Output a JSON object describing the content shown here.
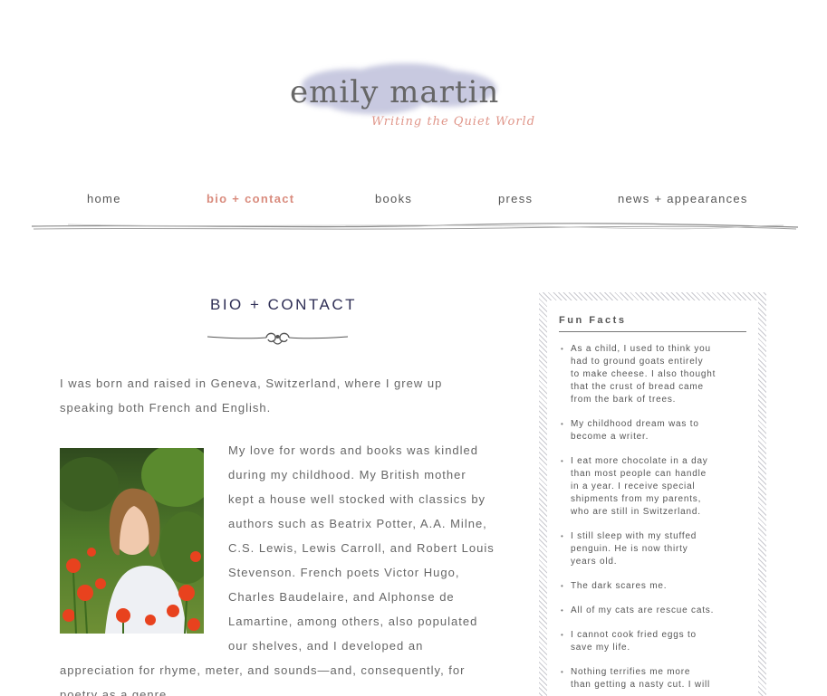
{
  "site": {
    "name": "emily martin",
    "tagline": "Writing the Quiet World"
  },
  "nav": {
    "items": [
      {
        "label": "home"
      },
      {
        "label": "bio + contact"
      },
      {
        "label": "books"
      },
      {
        "label": "press"
      },
      {
        "label": "news + appearances"
      }
    ],
    "active": "bio + contact"
  },
  "main": {
    "title": "BIO + CONTACT",
    "p1_lines": [
      "I was born and raised in Geneva, Switzerland, where I grew up",
      "speaking both French and English."
    ],
    "p2_lines": [
      "My love for words and books was kindled",
      "during my childhood. My British mother",
      "kept a house well stocked with classics by",
      "authors such as Beatrix Potter, A.A. Milne,",
      "C.S. Lewis, Lewis Carroll, and Robert Louis",
      "Stevenson. French poets Victor Hugo,",
      "Charles Baudelaire, and Alphonse de",
      "Lamartine, among others, also populated",
      "our shelves, and I developed an",
      "appreciation for rhyme, meter, and sounds—and, consequently, for",
      "poetry as a genre."
    ]
  },
  "sidebar": {
    "title": "Fun Facts",
    "facts": [
      [
        "As a child, I used to think you",
        "had to ground goats entirely",
        "to make cheese. I also thought",
        "that the crust of bread came",
        "from the bark of trees."
      ],
      [
        "My childhood dream was to",
        "become a writer."
      ],
      [
        "I eat more chocolate in a day",
        "than most people can handle",
        "in a year. I receive special",
        "shipments from my parents,",
        "who are still in Switzerland."
      ],
      [
        "I still sleep with my stuffed",
        "penguin. He is now thirty",
        "years old."
      ],
      [
        "The dark scares me."
      ],
      [
        "All of my cats are rescue cats."
      ],
      [
        "I cannot cook fried eggs to",
        "save my life."
      ],
      [
        "Nothing terrifies me more",
        "than getting a nasty cut. I will"
      ]
    ]
  },
  "colors": {
    "accent": "#d98b7d",
    "title": "#2e2e55",
    "text": "#666666",
    "watercolor": "#b6b8d6"
  }
}
